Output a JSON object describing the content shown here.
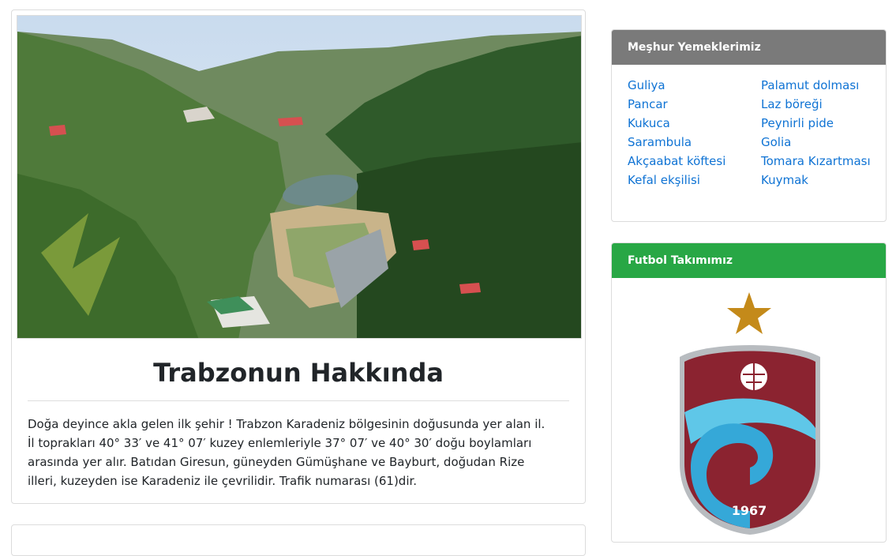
{
  "article": {
    "title": "Trabzonun Hakkında",
    "body": "Doğa deyince akla gelen ilk şehir ! Trabzon Karadeniz bölgesinin doğusunda yer alan il. İl toprakları 40° 33′ ve 41° 07′ kuzey enlemleriyle 37° 07′ ve 40° 30′ doğu boylamları arasında yer alır. Batıdan Giresun, güneyden Gümüşhane ve Bayburt, doğudan Rize illeri, kuzeyden ise Karadeniz ile çevrilidir. Trafik numarası (61)dir."
  },
  "foods": {
    "title": "Meşhur Yemeklerimiz",
    "header_color": "#7a7a7a",
    "items": [
      "Guliya",
      "Pancar",
      "Kukuca",
      "Sarambula",
      "Akçaabat köftesi",
      "Kefal ekşilisi",
      "Palamut dolması",
      "Laz böreği",
      "Peynirli pide",
      "Golia",
      "Tomara Kızartması",
      "Kuymak"
    ],
    "link_color": "#0f73d4"
  },
  "team": {
    "title": "Futbol Takımımız",
    "header_color": "#28a745",
    "crest_year": "1967"
  }
}
